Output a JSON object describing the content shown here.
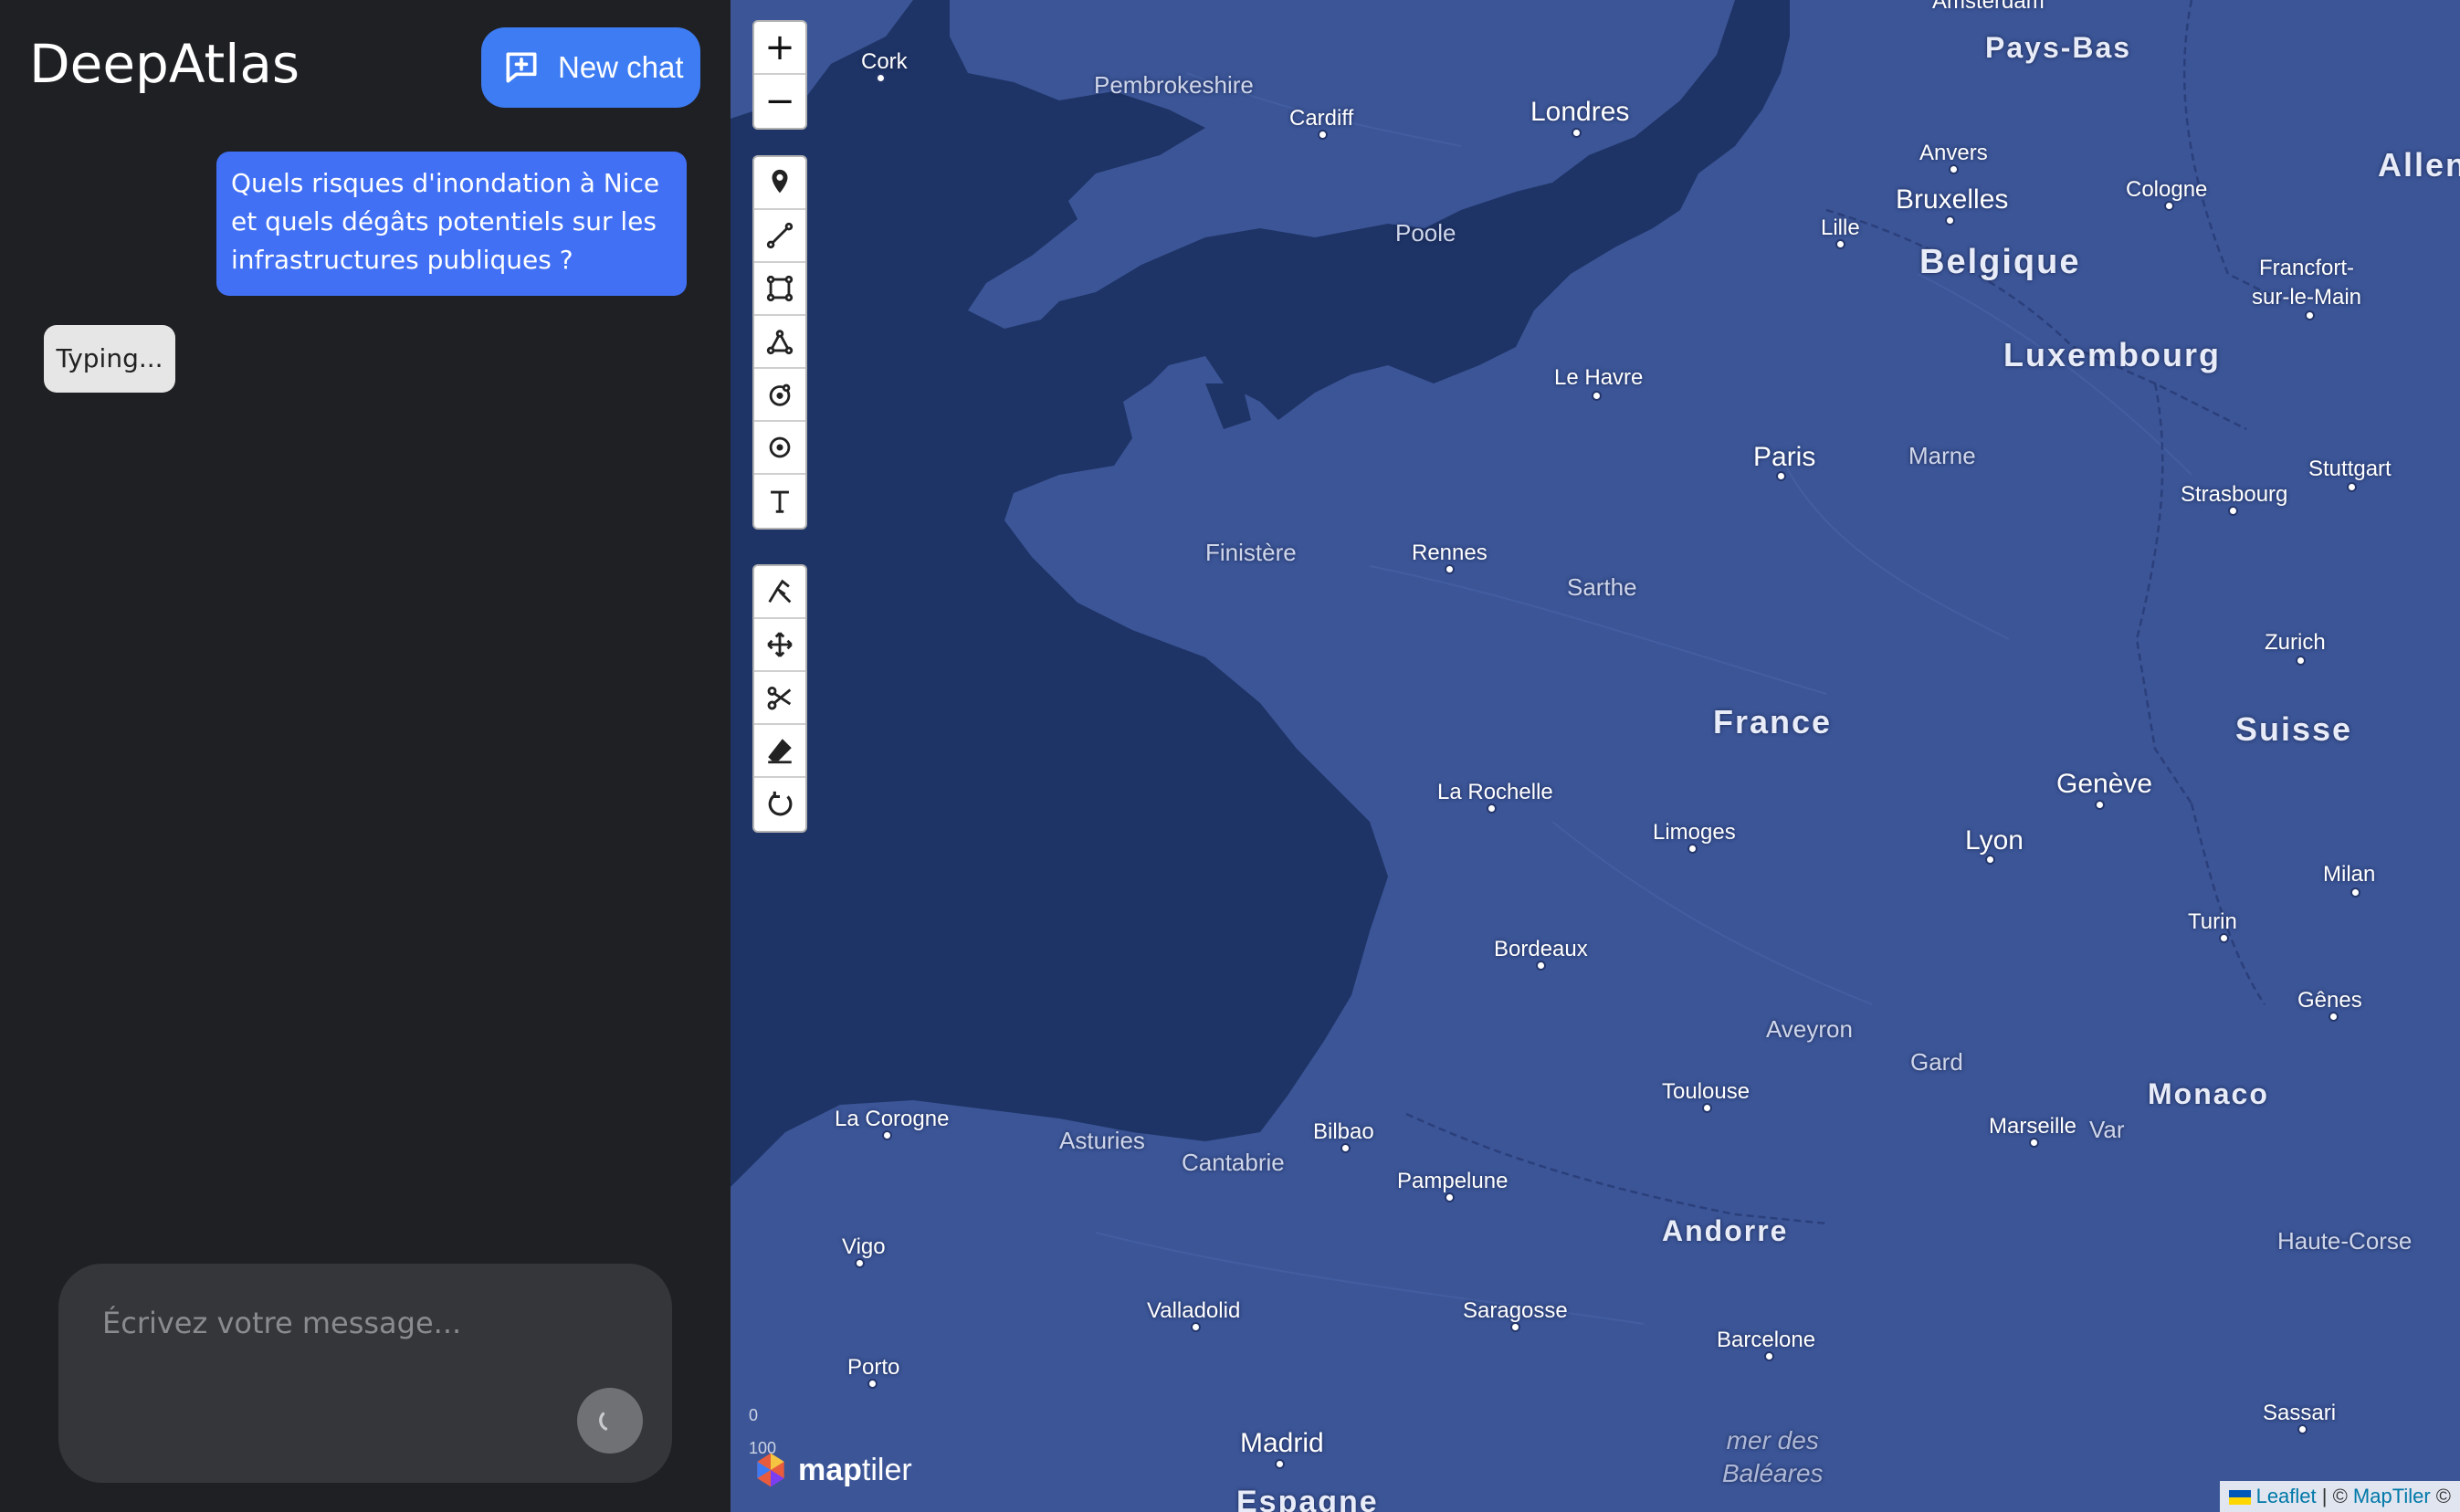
{
  "sidebar": {
    "brand": "DeepAtlas",
    "new_chat_label": "New chat",
    "user_message": "Quels risques d'inondation à Nice et quels dégâts potentiels sur les infrastructures publiques ?",
    "typing_indicator": "Typing...",
    "composer_placeholder": "Écrivez votre message...",
    "colors": {
      "background": "#1f2024",
      "accent": "#3d7cf2",
      "user_bubble": "#4170f4"
    }
  },
  "map": {
    "zoom_in": "+",
    "zoom_out": "−",
    "draw_tools": [
      "marker-icon",
      "polyline-icon",
      "rectangle-icon",
      "polygon-icon",
      "circle-icon",
      "circle-marker-icon",
      "text-icon"
    ],
    "edit_tools": [
      "cut-polygon-icon",
      "drag-icon",
      "scissors-icon",
      "eraser-icon",
      "rotate-icon"
    ],
    "scale_top": "0",
    "scale_bottom": "100",
    "logo_text_bold": "map",
    "logo_text": "tiler",
    "attribution_leaflet": "Leaflet",
    "attribution_sep": " | © ",
    "attribution_maptiler": "MapTiler",
    "attribution_tail": " ©",
    "labels": {
      "cork": "Cork",
      "pembrokeshire": "Pembrokeshire",
      "cardiff": "Cardiff",
      "londres": "Londres",
      "poole": "Poole",
      "amsterdam": "Amsterdam",
      "pays_bas": "Pays-Bas",
      "anvers": "Anvers",
      "bruxelles": "Bruxelles",
      "cologne": "Cologne",
      "lille": "Lille",
      "belgique": "Belgique",
      "allemagne": "Allen",
      "francfort": "Francfort-\nsur-le-Main",
      "luxembourg": "Luxembourg",
      "le_havre": "Le Havre",
      "paris": "Paris",
      "marne": "Marne",
      "stuttgart": "Stuttgart",
      "strasbourg": "Strasbourg",
      "finistere": "Finistère",
      "rennes": "Rennes",
      "sarthe": "Sarthe",
      "zurich": "Zurich",
      "france": "France",
      "suisse": "Suisse",
      "geneve": "Genève",
      "la_rochelle": "La Rochelle",
      "limoges": "Limoges",
      "lyon": "Lyon",
      "milan": "Milan",
      "turin": "Turin",
      "bordeaux": "Bordeaux",
      "genes": "Gênes",
      "aveyron": "Aveyron",
      "gard": "Gard",
      "monaco": "Monaco",
      "toulouse": "Toulouse",
      "la_corogne": "La Corogne",
      "asturies": "Asturies",
      "bilbao": "Bilbao",
      "cantabrie": "Cantabrie",
      "marseille": "Marseille",
      "var": "Var",
      "pampelune": "Pampelune",
      "andorre": "Andorre",
      "haute_corse": "Haute-Corse",
      "vigo": "Vigo",
      "valladolid": "Valladolid",
      "saragosse": "Saragosse",
      "barcelone": "Barcelone",
      "porto": "Porto",
      "madrid": "Madrid",
      "espagne": "Espagne",
      "mer_des_baleares": "mer des\nBaléares",
      "sassari": "Sassari"
    },
    "colors": {
      "water": "#1e3466",
      "land": "#3b5597",
      "label": "#ffffff"
    }
  }
}
